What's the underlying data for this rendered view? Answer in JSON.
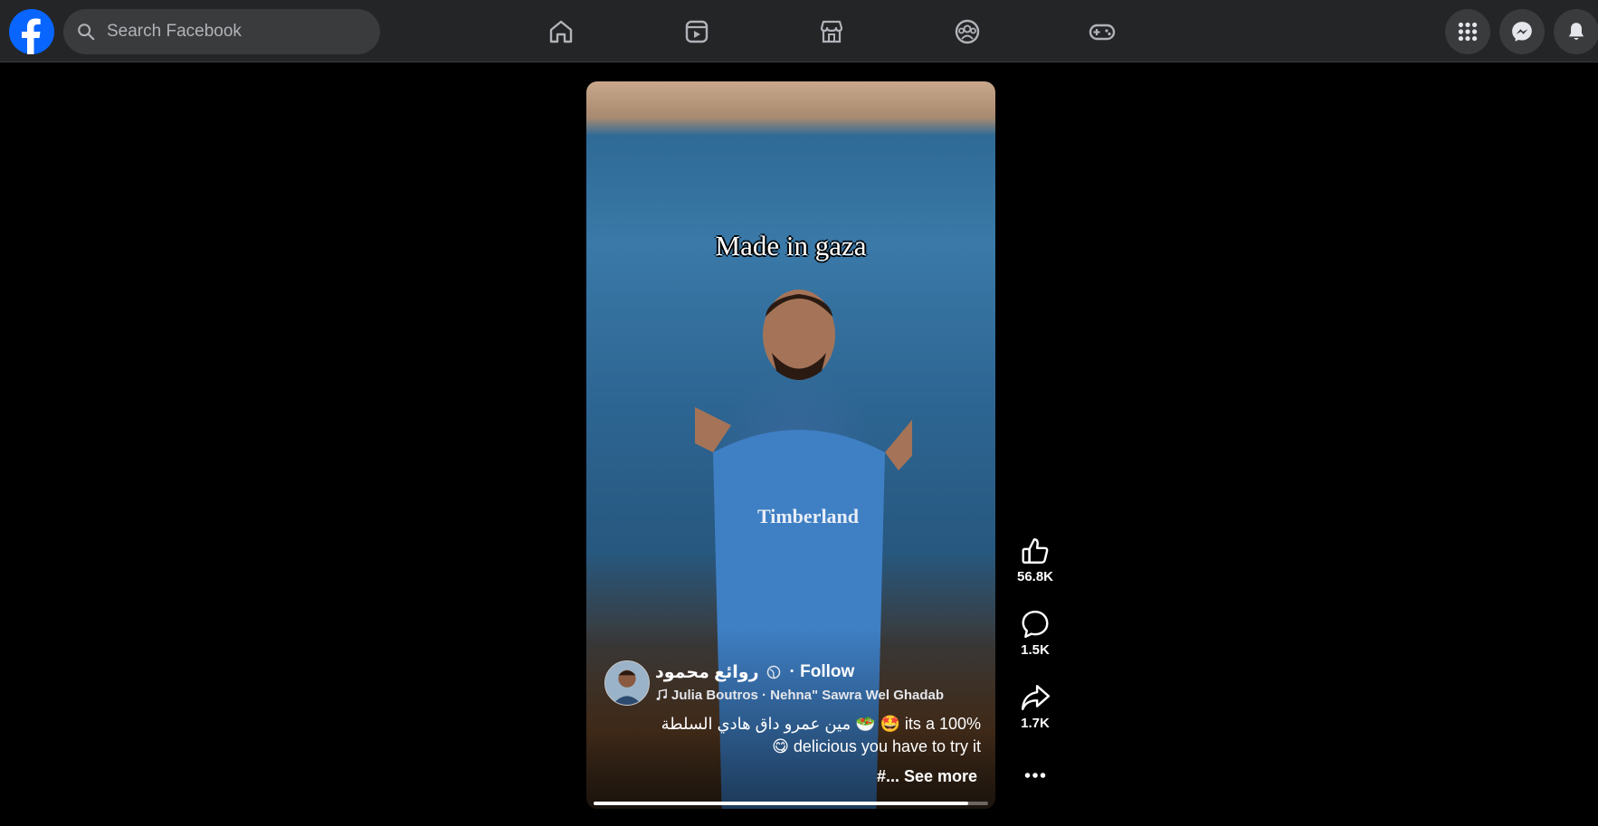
{
  "search": {
    "placeholder": "Search Facebook"
  },
  "nav": {
    "icons": [
      "home-icon",
      "video-icon",
      "marketplace-icon",
      "groups-icon",
      "gaming-icon"
    ]
  },
  "header_right": {
    "icons": [
      "menu-grid-icon",
      "messenger-icon",
      "notifications-icon"
    ]
  },
  "reel": {
    "overlay_text": "Made in gaza",
    "shirt_text": "Timberland",
    "author": {
      "name": "روائع محمود",
      "follow_label": "· Follow"
    },
    "music": "Julia Boutros · Nehna\" Sawra Wel Ghadab",
    "caption_line1": "مين عمرو داق هادي السلطة 🥗 🤩  its a 100%",
    "caption_line2": "😋 delicious you have to try it",
    "see_more": "#... See more",
    "progress": 0.95
  },
  "actions": {
    "likes": "56.8K",
    "comments": "1.5K",
    "shares": "1.7K"
  },
  "colors": {
    "topbar": "#242526",
    "search_bg": "#3a3b3c",
    "brand": "#0866ff",
    "background": "#000000"
  }
}
